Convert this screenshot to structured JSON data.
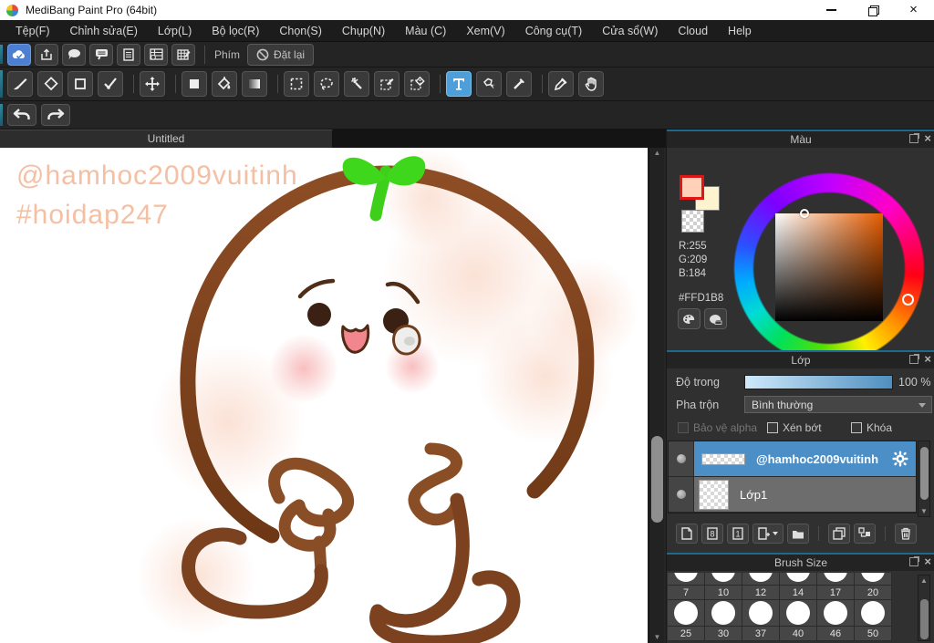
{
  "window": {
    "title": "MediBang Paint Pro (64bit)",
    "controls": [
      "minimize",
      "restore",
      "close"
    ],
    "close_glyph": "×"
  },
  "menu": {
    "items": [
      "Tệp(F)",
      "Chỉnh sửa(E)",
      "Lớp(L)",
      "Bộ lọc(R)",
      "Chọn(S)",
      "Chụp(N)",
      "Màu (C)",
      "Xem(V)",
      "Công cụ(T)",
      "Cửa sổ(W)",
      "Cloud",
      "Help"
    ]
  },
  "quickbar": {
    "icons": [
      "cloud-sync",
      "export",
      "comment",
      "comment-lines",
      "document",
      "grid-clock",
      "grid-edit"
    ],
    "phim_label": "Phím",
    "reset_label": "Đặt lại"
  },
  "tools": {
    "names": [
      "brush",
      "eraser",
      "dot",
      "polyline",
      "move",
      "fill-rect",
      "bucket",
      "gradient",
      "select-rect",
      "lasso",
      "magic-wand",
      "select-pen",
      "select-eraser",
      "text",
      "operation",
      "divide",
      "eyedropper",
      "hand"
    ],
    "selected": "text"
  },
  "history": {
    "icons": [
      "undo",
      "redo"
    ]
  },
  "tab": {
    "title": "Untitled"
  },
  "canvas": {
    "watermark_line1": "@hamhoc2009vuitinh",
    "watermark_line2": "#hoidap247"
  },
  "color_panel": {
    "title": "Màu",
    "r_label": "R:255",
    "g_label": "G:209",
    "b_label": "B:184",
    "hex_label": "#FFD1B8",
    "foreground_color": "#FFD1B8",
    "background_color": "#FDF3CF",
    "icons": [
      "palette",
      "palette-edit"
    ]
  },
  "layer_panel": {
    "title": "Lớp",
    "opacity_label": "Độ trong",
    "opacity_value": "100 %",
    "blend_label": "Pha trộn",
    "blend_value": "Bình thường",
    "alpha_label": "Bảo vệ alpha",
    "clip_label": "Xén bớt",
    "lock_label": "Khóa",
    "layers": [
      {
        "name": "@hamhoc2009vuitinh",
        "selected": true
      },
      {
        "name": "Lớp1",
        "selected": false
      }
    ],
    "toolbar_icons": [
      "new-layer",
      "new-8bit-layer",
      "new-1bit-layer",
      "add-layer-menu",
      "folder",
      "duplicate-layer",
      "merge-layer",
      "delete-layer"
    ]
  },
  "brush_panel": {
    "title": "Brush Size",
    "row1": [
      "7",
      "10",
      "12",
      "14",
      "17",
      "20"
    ],
    "row2": [
      "25",
      "30",
      "37",
      "40",
      "46",
      "50"
    ]
  }
}
